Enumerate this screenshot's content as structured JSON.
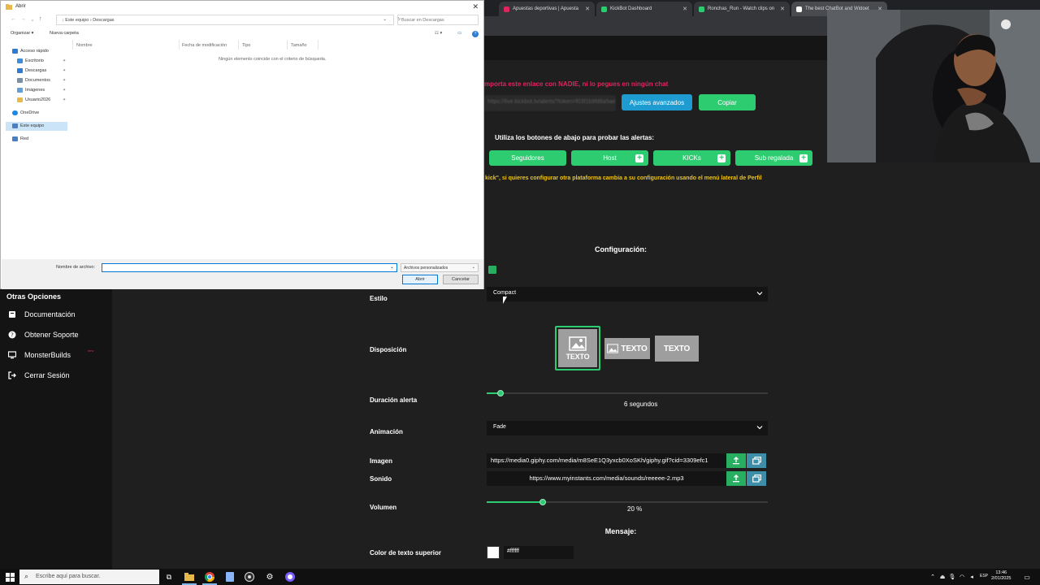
{
  "browser": {
    "tabs": [
      {
        "title": "Apuestas deportivas | Apuesta",
        "favicon_color": "#e0245e"
      },
      {
        "title": "KickBot Dashboard",
        "favicon_color": "#2ecc71"
      },
      {
        "title": "Ronchas_Run - Watch clips on",
        "favicon_color": "#2ecc71"
      },
      {
        "title": "The best ChatBot and Widget",
        "favicon_color": "#ffffff"
      }
    ]
  },
  "app": {
    "warning": "mporta este enlace con NADIE, ni lo pegues en ningún chat",
    "link_placeholder": "https://live.kickbot.tv/alerts/?token=f03f1b9fd8a5ae2bef",
    "advanced_button": "Ajustes avanzados",
    "copy_button": "Copiar",
    "test_label": "Utiliza los botones de abajo para probar las alertas:",
    "test_buttons": [
      "Seguidores",
      "Host",
      "KICKs",
      "Sub regalada"
    ],
    "info": "kick\", si quieres configurar otra plataforma cambia a su configuración usando el menú lateral de Perfil",
    "config_title": "Configuración:",
    "style_label": "Estilo",
    "style_value": "Compact",
    "layout_label": "Disposición",
    "layout_text": "TEXTO",
    "duration_label": "Duración alerta",
    "duration_value": "6",
    "duration_unit": "segundos",
    "duration_fraction": 0.05,
    "animation_label": "Animación",
    "animation_value": "Fade",
    "image_label": "Imagen",
    "image_url": "https://media0.giphy.com/media/m8SeE1Q3yxcb0XoSKh/giphy.gif?cid=3309efc1",
    "sound_label": "Sonido",
    "sound_url": "https://www.myinstants.com/media/sounds/reeeee-2.mp3",
    "volume_label": "Volumen",
    "volume_value": "20",
    "volume_unit": "%",
    "volume_fraction": 0.2,
    "message_title": "Mensaje:",
    "top_text_color_label": "Color de texto superior",
    "top_text_color": "#ffffff"
  },
  "sidebar": {
    "heading": "Otras Opciones",
    "items": [
      {
        "label": "Documentación",
        "icon": "book-icon"
      },
      {
        "label": "Obtener Soporte",
        "icon": "question-icon"
      },
      {
        "label": "MonsterBuilds",
        "icon": "monitor-icon"
      },
      {
        "label": "Cerrar Sesión",
        "icon": "logout-icon"
      }
    ],
    "new_badge": "new"
  },
  "dialog": {
    "title": "Abrir",
    "path": [
      "Este equipo",
      "Descargas"
    ],
    "search_placeholder": "Buscar en Descargas",
    "organize": "Organizar",
    "new_folder": "Nueva carpeta",
    "columns": [
      "Nombre",
      "Fecha de modificación",
      "Tipo",
      "Tamaño"
    ],
    "empty_message": "Ningún elemento coincide con el criterio de búsqueda.",
    "nav_items": [
      {
        "label": "Acceso rápido",
        "icon_color": "#2f7bd1",
        "pinned": false
      },
      {
        "label": "Escritorio",
        "icon_color": "#3b8edc",
        "pinned": true
      },
      {
        "label": "Descargas",
        "icon_color": "#2f7bd1",
        "pinned": true
      },
      {
        "label": "Documentos",
        "icon_color": "#7a8fa8",
        "pinned": true
      },
      {
        "label": "Imágenes",
        "icon_color": "#5fa0d8",
        "pinned": true
      },
      {
        "label": "Usuario2026",
        "icon_color": "#e6b94a",
        "pinned": true
      },
      {
        "label": "OneDrive",
        "icon_color": "#1e88e5",
        "pinned": false
      },
      {
        "label": "Este equipo",
        "icon_color": "#4a7fc1",
        "pinned": false
      },
      {
        "label": "Red",
        "icon_color": "#4a7fc1",
        "pinned": false
      }
    ],
    "pin_glyph": "✦",
    "filename_label": "Nombre de archivo:",
    "filetype": "Archivos personalizados",
    "open_button": "Abrir",
    "cancel_button": "Cancelar"
  },
  "taskbar": {
    "search_placeholder": "Escribe aquí para buscar.",
    "lang": "ESP",
    "time": "13:46",
    "date": "2/01/2025"
  }
}
